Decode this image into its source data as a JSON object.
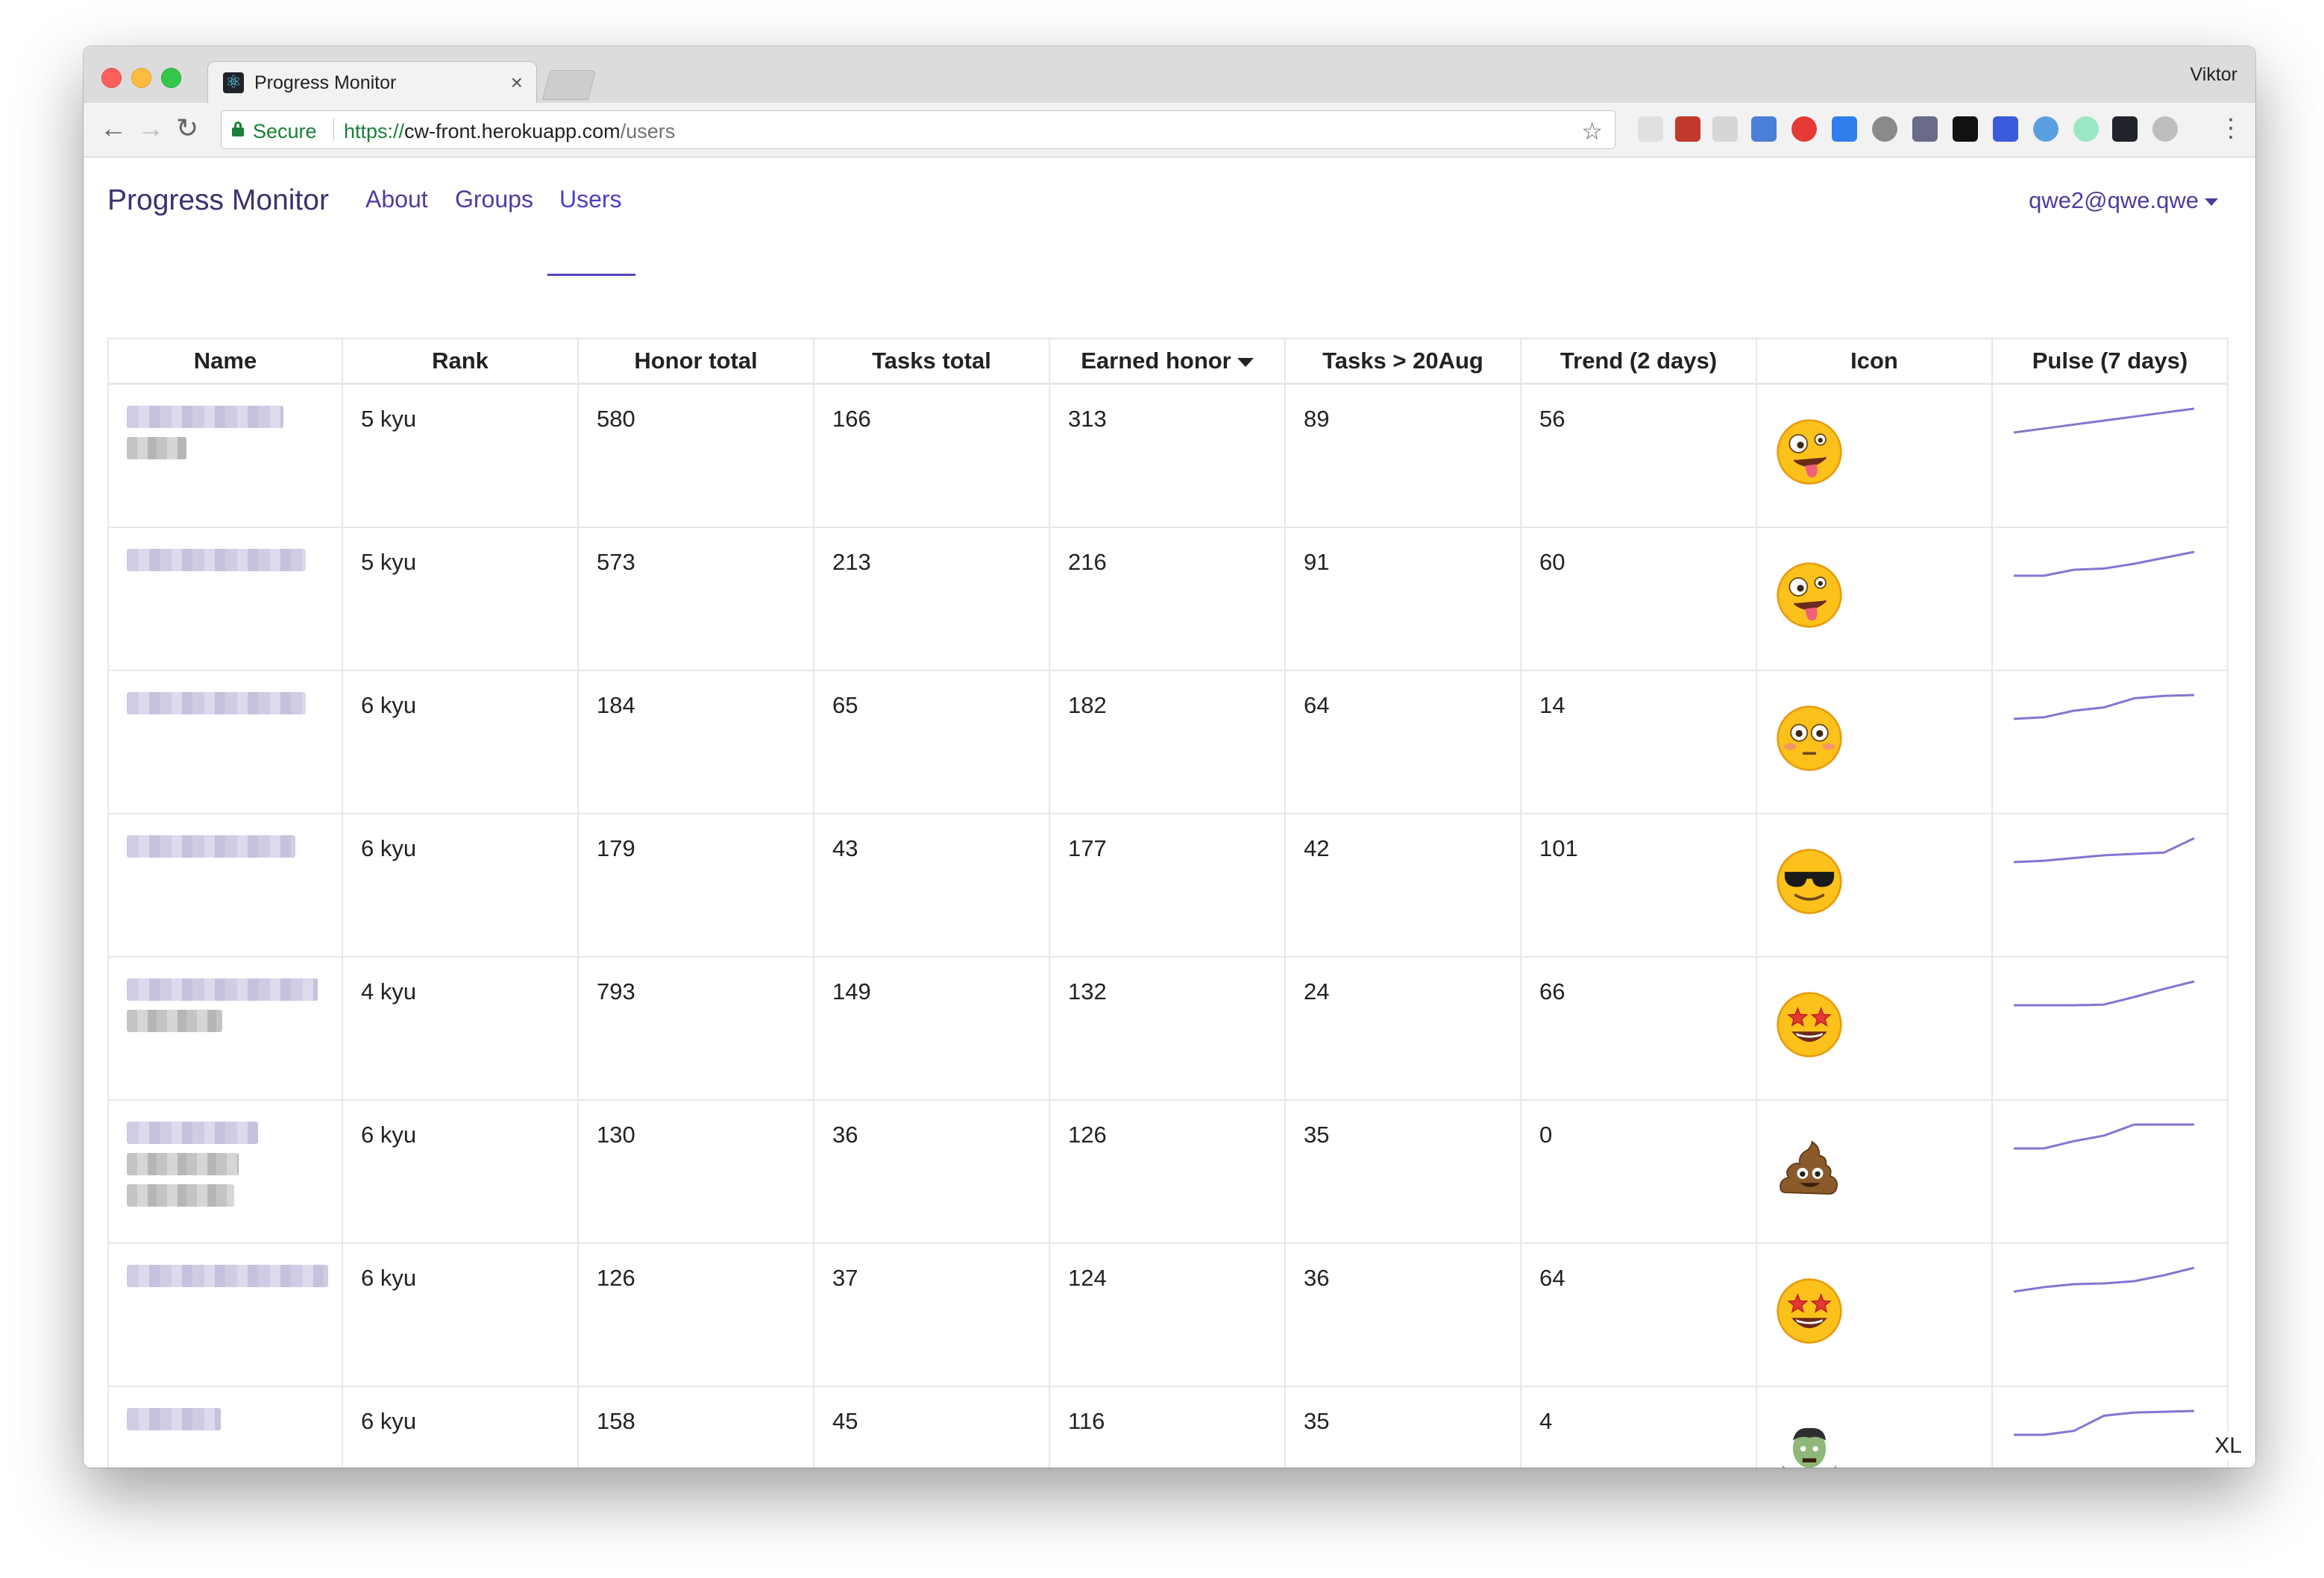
{
  "browser": {
    "tab_title": "Progress Monitor",
    "tab_close": "×",
    "profile_name": "Viktor",
    "secure_label": "Secure",
    "url_scheme": "https://",
    "url_host": "cw-front.herokuapp.com",
    "url_path": "/users"
  },
  "navbar": {
    "brand": "Progress Monitor",
    "links": [
      "About",
      "Groups",
      "Users"
    ],
    "active_link": "Users",
    "user_email": "qwe2@qwe.qwe"
  },
  "table": {
    "headers": [
      "Name",
      "Rank",
      "Honor total",
      "Tasks total",
      "Earned honor",
      "Tasks > 20Aug",
      "Trend (2 days)",
      "Icon",
      "Pulse (7 days)"
    ],
    "sorted_by": "Earned honor",
    "rows": [
      {
        "rank": "5 kyu",
        "honor_total": "580",
        "tasks_total": "166",
        "earned_honor": "313",
        "tasks_since": "89",
        "trend": "56",
        "icon": "zany-face",
        "pulse": [
          1,
          2,
          3,
          4,
          5,
          6,
          7
        ]
      },
      {
        "rank": "5 kyu",
        "honor_total": "573",
        "tasks_total": "213",
        "earned_honor": "216",
        "tasks_since": "91",
        "trend": "60",
        "icon": "zany-face",
        "pulse": [
          1,
          1,
          2,
          2.2,
          3,
          4,
          5
        ]
      },
      {
        "rank": "6 kyu",
        "honor_total": "184",
        "tasks_total": "65",
        "earned_honor": "182",
        "tasks_since": "64",
        "trend": "14",
        "icon": "flushed-face",
        "pulse": [
          1,
          1.2,
          2,
          2.4,
          3.5,
          3.8,
          3.9
        ]
      },
      {
        "rank": "6 kyu",
        "honor_total": "179",
        "tasks_total": "43",
        "earned_honor": "177",
        "tasks_since": "42",
        "trend": "101",
        "icon": "sunglasses-face",
        "pulse": [
          1,
          1.2,
          1.6,
          2,
          2.2,
          2.4,
          4.5
        ]
      },
      {
        "rank": "4 kyu",
        "honor_total": "793",
        "tasks_total": "149",
        "earned_honor": "132",
        "tasks_since": "24",
        "trend": "66",
        "icon": "star-struck-face",
        "pulse": [
          1,
          1,
          1,
          1.1,
          2.2,
          3.4,
          4.5
        ]
      },
      {
        "rank": "6 kyu",
        "honor_total": "130",
        "tasks_total": "36",
        "earned_honor": "126",
        "tasks_since": "35",
        "trend": "0",
        "icon": "pile-of-poo",
        "pulse": [
          1,
          1,
          1.8,
          2.4,
          3.6,
          3.6,
          3.6
        ]
      },
      {
        "rank": "6 kyu",
        "honor_total": "126",
        "tasks_total": "37",
        "earned_honor": "124",
        "tasks_since": "36",
        "trend": "64",
        "icon": "star-struck-face",
        "pulse": [
          1,
          1.6,
          2,
          2.1,
          2.4,
          3.2,
          4.2
        ]
      },
      {
        "rank": "6 kyu",
        "honor_total": "158",
        "tasks_total": "45",
        "earned_honor": "116",
        "tasks_since": "35",
        "trend": "4",
        "icon": "zombie",
        "pulse": [
          1,
          1,
          1.5,
          3.4,
          3.8,
          3.9,
          4
        ]
      }
    ]
  },
  "breakpoint_badge": "XL",
  "colors": {
    "accent": "#4a3fa0",
    "pulse_line": "#8276d2",
    "border": "#e7e7eb"
  }
}
